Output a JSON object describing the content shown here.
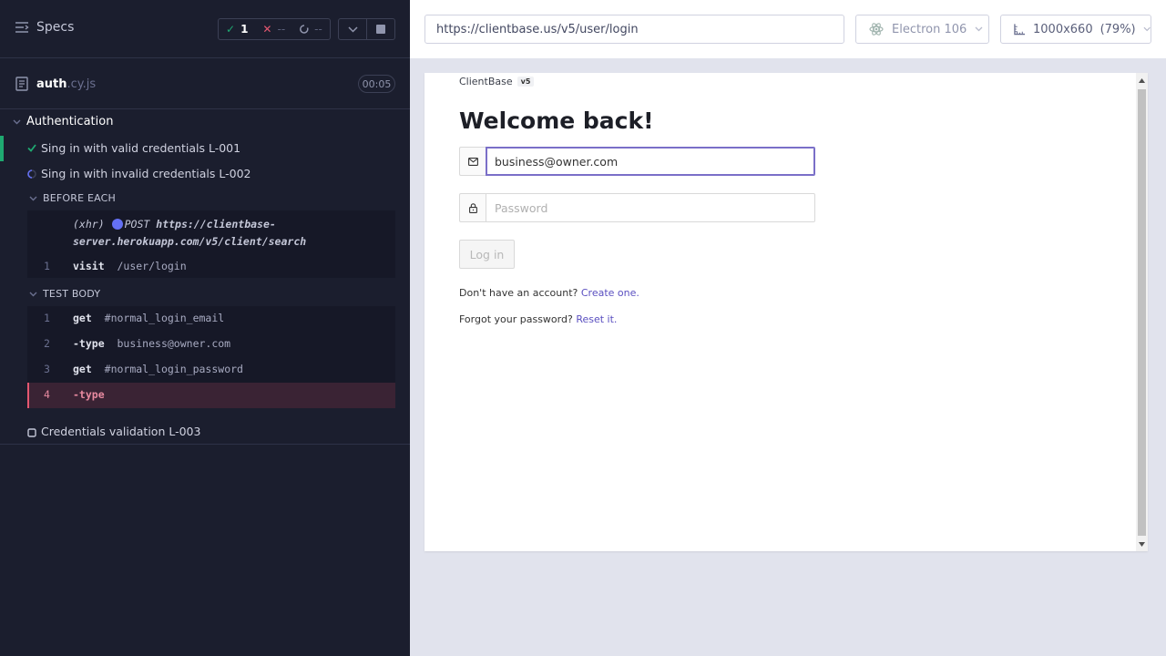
{
  "reporter": {
    "specs_label": "Specs",
    "stats": {
      "passed": "1",
      "failed": "--",
      "pending": "--"
    },
    "spec": {
      "name": "auth",
      "ext": ".cy.js",
      "duration": "00:05"
    },
    "suite": {
      "title": "Authentication",
      "tests": [
        {
          "label": "Sing in with valid credentials L-001",
          "state": "passed"
        },
        {
          "label": "Sing in with invalid credentials L-002",
          "state": "running"
        },
        {
          "label": "Credentials validation L-003",
          "state": "pending"
        }
      ]
    },
    "before_each": {
      "title": "BEFORE EACH",
      "xhr_name": "(xhr)",
      "xhr_method": "POST",
      "xhr_url_line1": "https://clientbase-",
      "xhr_url_line2": "server.herokuapp.com/v5/client/search",
      "commands": [
        {
          "num": "1",
          "name": "visit",
          "arg": "/user/login"
        }
      ]
    },
    "test_body": {
      "title": "TEST BODY",
      "commands": [
        {
          "num": "1",
          "name": "get",
          "arg": "#normal_login_email"
        },
        {
          "num": "2",
          "name": "-type",
          "arg": "business@owner.com"
        },
        {
          "num": "3",
          "name": "get",
          "arg": "#normal_login_password"
        },
        {
          "num": "4",
          "name": "-type",
          "arg": ""
        }
      ]
    }
  },
  "aut_header": {
    "url": "https://clientbase.us/v5/user/login",
    "browser": "Electron 106",
    "viewport": "1000x660",
    "scale": "(79%)"
  },
  "app": {
    "brand": "ClientBase",
    "version": "v5",
    "heading": "Welcome back!",
    "email_value": "business@owner.com",
    "password_placeholder": "Password",
    "login_label": "Log in",
    "signup_text": "Don't have an account? ",
    "signup_link": "Create one.",
    "forgot_text": "Forgot your password? ",
    "forgot_link": "Reset it."
  },
  "colors": {
    "reporter_bg": "#1b1e2e",
    "passed": "#1fa971",
    "failed": "#e45770",
    "running": "#6470f3",
    "focus": "#7a6fc8"
  }
}
